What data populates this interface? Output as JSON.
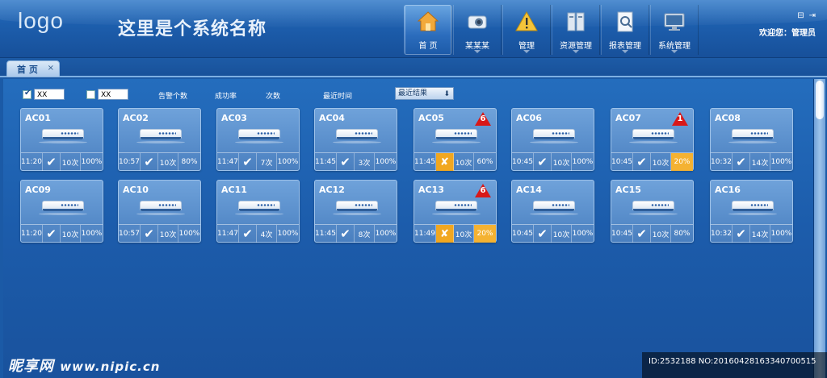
{
  "header": {
    "logo": "logo",
    "system_name": "这里是个系统名称",
    "welcome": "欢迎您：管理员",
    "nav": [
      {
        "label": "首 页",
        "icon": "home-icon",
        "active": true
      },
      {
        "label": "某某某",
        "icon": "camera-icon",
        "active": false
      },
      {
        "label": "管理",
        "icon": "warning-icon",
        "active": false
      },
      {
        "label": "资源管理",
        "icon": "server-icon",
        "active": false
      },
      {
        "label": "报表管理",
        "icon": "report-icon",
        "active": false
      },
      {
        "label": "系统管理",
        "icon": "monitor-icon",
        "active": false
      }
    ]
  },
  "tabs": [
    {
      "label": "首 页",
      "close": "×"
    }
  ],
  "filter": {
    "input1": "XX",
    "input2": "XX",
    "labels": [
      "告警个数",
      "成功率",
      "次数",
      "最近时间"
    ],
    "select": "最近结果"
  },
  "cards": [
    {
      "name": "AC01",
      "time": "11:20",
      "status": "ok",
      "count": "10次",
      "rate": "100%",
      "alert": null,
      "rate_warn": false
    },
    {
      "name": "AC02",
      "time": "10:57",
      "status": "ok",
      "count": "10次",
      "rate": "80%",
      "alert": null,
      "rate_warn": false
    },
    {
      "name": "AC03",
      "time": "11:47",
      "status": "ok",
      "count": "7次",
      "rate": "100%",
      "alert": null,
      "rate_warn": false
    },
    {
      "name": "AC04",
      "time": "11:45",
      "status": "ok",
      "count": "3次",
      "rate": "100%",
      "alert": null,
      "rate_warn": false
    },
    {
      "name": "AC05",
      "time": "11:45",
      "status": "fail",
      "count": "10次",
      "rate": "60%",
      "alert": "6",
      "rate_warn": false
    },
    {
      "name": "AC06",
      "time": "10:45",
      "status": "ok",
      "count": "10次",
      "rate": "100%",
      "alert": null,
      "rate_warn": false
    },
    {
      "name": "AC07",
      "time": "10:45",
      "status": "ok",
      "count": "10次",
      "rate": "20%",
      "alert": "1",
      "rate_warn": true
    },
    {
      "name": "AC08",
      "time": "10:32",
      "status": "ok",
      "count": "14次",
      "rate": "100%",
      "alert": null,
      "rate_warn": false
    },
    {
      "name": "AC09",
      "time": "11:20",
      "status": "ok",
      "count": "10次",
      "rate": "100%",
      "alert": null,
      "rate_warn": false
    },
    {
      "name": "AC10",
      "time": "10:57",
      "status": "ok",
      "count": "10次",
      "rate": "100%",
      "alert": null,
      "rate_warn": false
    },
    {
      "name": "AC11",
      "time": "11:47",
      "status": "ok",
      "count": "4次",
      "rate": "100%",
      "alert": null,
      "rate_warn": false
    },
    {
      "name": "AC12",
      "time": "11:45",
      "status": "ok",
      "count": "8次",
      "rate": "100%",
      "alert": null,
      "rate_warn": false
    },
    {
      "name": "AC13",
      "time": "11:49",
      "status": "fail",
      "count": "10次",
      "rate": "20%",
      "alert": "6",
      "rate_warn": true
    },
    {
      "name": "AC14",
      "time": "10:45",
      "status": "ok",
      "count": "10次",
      "rate": "100%",
      "alert": null,
      "rate_warn": false
    },
    {
      "name": "AC15",
      "time": "10:45",
      "status": "ok",
      "count": "10次",
      "rate": "80%",
      "alert": null,
      "rate_warn": false
    },
    {
      "name": "AC16",
      "time": "10:32",
      "status": "ok",
      "count": "14次",
      "rate": "100%",
      "alert": null,
      "rate_warn": false
    }
  ],
  "status_glyphs": {
    "ok": "✔",
    "fail": "✘"
  },
  "watermark": {
    "brand": "昵享网",
    "site": "www.nipic.cn",
    "id_text": "ID:2532188 NO:20160428163340700515"
  },
  "colors": {
    "alert": "#d91818",
    "warn": "#f4b232",
    "fail": "#f1a720"
  }
}
